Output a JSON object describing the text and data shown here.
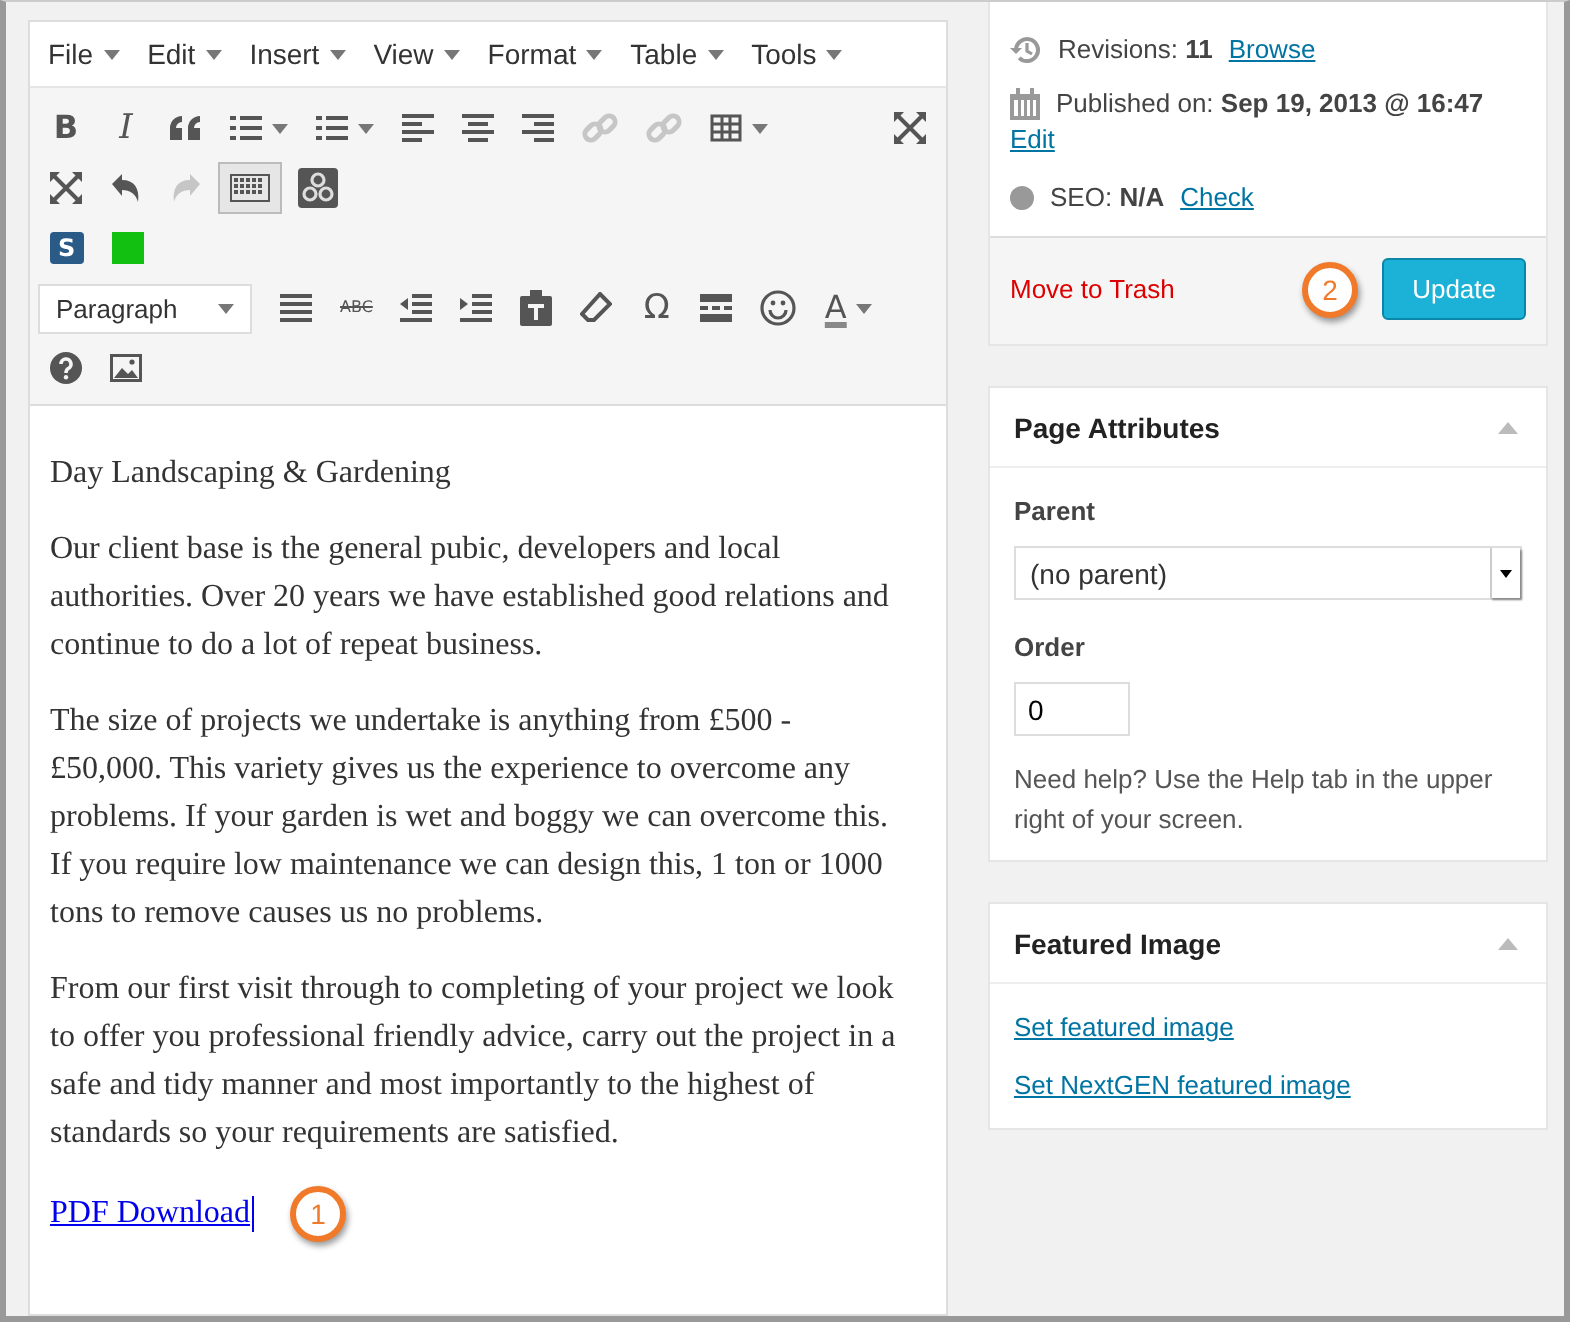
{
  "menu": [
    "File",
    "Edit",
    "Insert",
    "View",
    "Format",
    "Table",
    "Tools"
  ],
  "toolbar_rows": [
    [
      {
        "kind": "bold",
        "glyph": "B",
        "disabled": false,
        "selected": false,
        "dropdown": false
      },
      {
        "kind": "italic",
        "glyph": "I",
        "disabled": false,
        "selected": false,
        "dropdown": false
      },
      {
        "kind": "quote",
        "disabled": false,
        "selected": false,
        "dropdown": false
      },
      {
        "kind": "bullets",
        "disabled": false,
        "selected": false,
        "dropdown": true
      },
      {
        "kind": "numbers",
        "disabled": false,
        "selected": false,
        "dropdown": true
      },
      {
        "kind": "align-left",
        "disabled": false,
        "selected": false,
        "dropdown": false
      },
      {
        "kind": "align-center",
        "disabled": false,
        "selected": false,
        "dropdown": false
      },
      {
        "kind": "align-right",
        "disabled": false,
        "selected": false,
        "dropdown": false
      },
      {
        "kind": "link",
        "disabled": true,
        "selected": false,
        "dropdown": false
      },
      {
        "kind": "unlink",
        "disabled": true,
        "selected": false,
        "dropdown": false
      },
      {
        "kind": "table",
        "disabled": false,
        "selected": false,
        "dropdown": true
      },
      {
        "kind": "expand",
        "disabled": false,
        "selected": false,
        "dropdown": false
      }
    ],
    [
      {
        "kind": "collapse",
        "disabled": false,
        "selected": false,
        "dropdown": false
      },
      {
        "kind": "undo",
        "disabled": false,
        "selected": false,
        "dropdown": false
      },
      {
        "kind": "redo",
        "disabled": true,
        "selected": false,
        "dropdown": false
      },
      {
        "kind": "keyboard",
        "disabled": false,
        "selected": true,
        "dropdown": false
      },
      {
        "kind": "plugin",
        "disabled": false,
        "selected": false,
        "dropdown": false
      }
    ],
    [
      {
        "kind": "badge",
        "glyph": "S",
        "disabled": false,
        "selected": false,
        "dropdown": false
      },
      {
        "kind": "square",
        "disabled": false,
        "selected": false,
        "dropdown": false
      }
    ],
    [
      {
        "kind": "select",
        "glyph": "Paragraph",
        "disabled": false,
        "selected": false,
        "dropdown": true
      },
      {
        "kind": "justify",
        "disabled": false,
        "selected": false,
        "dropdown": false
      },
      {
        "kind": "strike",
        "glyph": "ABC",
        "disabled": false,
        "selected": false,
        "dropdown": false
      },
      {
        "kind": "outdent",
        "disabled": false,
        "selected": false,
        "dropdown": false
      },
      {
        "kind": "indent",
        "disabled": false,
        "selected": false,
        "dropdown": false
      },
      {
        "kind": "paste",
        "disabled": false,
        "selected": false,
        "dropdown": false
      },
      {
        "kind": "eraser",
        "disabled": false,
        "selected": false,
        "dropdown": false
      },
      {
        "kind": "omega",
        "glyph": "Ω",
        "disabled": false,
        "selected": false,
        "dropdown": false
      },
      {
        "kind": "more",
        "disabled": false,
        "selected": false,
        "dropdown": false
      },
      {
        "kind": "smiley",
        "disabled": false,
        "selected": false,
        "dropdown": false
      },
      {
        "kind": "color",
        "glyph": "A",
        "disabled": false,
        "selected": false,
        "dropdown": true
      }
    ],
    [
      {
        "kind": "help",
        "disabled": false,
        "selected": false,
        "dropdown": false
      },
      {
        "kind": "image",
        "disabled": false,
        "selected": false,
        "dropdown": false
      }
    ]
  ],
  "content": {
    "paragraphs": [
      "Day Landscaping & Gardening",
      "Our client base is the general pubic, developers and local authorities. Over 20 years we have established good relations and continue to do a lot of repeat business.",
      "The size of projects we undertake is anything from £500 - £50,000.  This variety gives us the experience to overcome any problems.  If your garden is wet and boggy we can overcome this.  If you require low maintenance we can design this, 1 ton or 1000 tons to remove causes us no problems.",
      "From our first visit through to completing of your project we look to offer you professional friendly advice, carry out the project in a safe and tidy manner and most importantly to the highest of standards so your requirements are satisfied."
    ],
    "link": "PDF Download",
    "callout": "1"
  },
  "publish": {
    "revisions": "Revisions: **11**",
    "revisions_link": "Browse",
    "published": "Published on: **Sep 19, 2013 @ 16:47**",
    "published_link": "Edit",
    "seo": "SEO: **N/A**",
    "seo_link": "Check",
    "trash": "Move to Trash",
    "callout": "2",
    "update": "Update"
  },
  "page_attributes": {
    "title": "Page Attributes",
    "parent_label": "Parent",
    "parent_value": "(no parent)",
    "order_label": "Order",
    "order_value": "0",
    "help": "Need help? Use the Help tab in the upper right of your screen."
  },
  "featured_image": {
    "title": "Featured Image",
    "links": [
      "Set featured image",
      "Set NextGEN featured image"
    ]
  }
}
